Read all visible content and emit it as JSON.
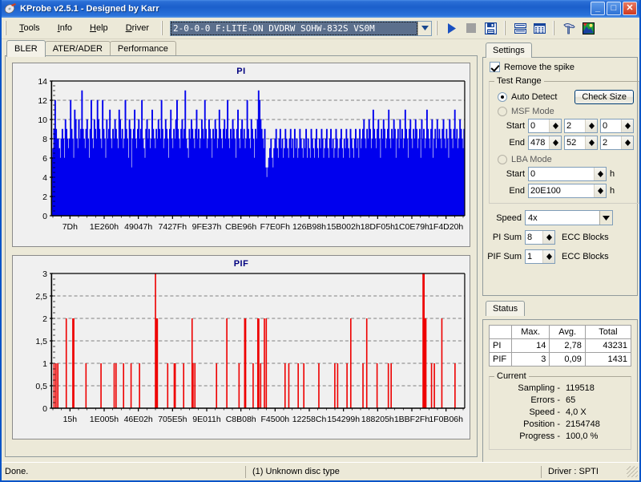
{
  "window": {
    "title": "KProbe v2.5.1 - Designed by Karr",
    "icon": "app-icon",
    "minimize": "_",
    "maximize": "□",
    "close": "✕"
  },
  "menu": {
    "items": [
      {
        "label": "Tools",
        "accel": "T"
      },
      {
        "label": "Info",
        "accel": "I"
      },
      {
        "label": "Help",
        "accel": "H"
      },
      {
        "label": "Driver",
        "accel": "D"
      }
    ]
  },
  "toolbar": {
    "drive": {
      "value": "2-0-0-0 F:LITE-ON DVDRW SOHW-832S  VS0M",
      "arrow_icon": "chevron-down-icon"
    },
    "buttons": [
      {
        "name": "start-scan-button",
        "icon": "play-icon"
      },
      {
        "name": "stop-scan-button",
        "icon": "stop-icon"
      },
      {
        "name": "save-button",
        "icon": "floppy-disk-icon"
      },
      {
        "name": "view-list-button",
        "icon": "list-view-icon"
      },
      {
        "name": "view-grid-button",
        "icon": "grid-view-icon"
      },
      {
        "name": "tools-button",
        "icon": "hammer-icon"
      },
      {
        "name": "image-button",
        "icon": "picture-icon"
      }
    ]
  },
  "tabs": [
    {
      "label": "BLER",
      "active": true
    },
    {
      "label": "ATER/ADER",
      "active": false
    },
    {
      "label": "Performance",
      "active": false
    }
  ],
  "settings": {
    "tab_label": "Settings",
    "remove_spike": {
      "label": "Remove the spike",
      "checked": true
    },
    "test_range": {
      "legend": "Test Range",
      "auto_detect": {
        "label": "Auto Detect",
        "selected": true
      },
      "check_size_button": "Check Size",
      "msf_mode": {
        "label": "MSF Mode",
        "selected": false
      },
      "msf_start": {
        "label": "Start",
        "values": [
          "0",
          "2",
          "0"
        ]
      },
      "msf_end": {
        "label": "End",
        "values": [
          "478",
          "52",
          "2"
        ]
      },
      "lba_mode": {
        "label": "LBA Mode",
        "selected": false
      },
      "lba_start": {
        "label": "Start",
        "value": "0",
        "unit": "h"
      },
      "lba_end": {
        "label": "End",
        "value": "20E100",
        "unit": "h"
      }
    },
    "speed": {
      "label": "Speed",
      "value": "4x"
    },
    "pi_sum": {
      "label": "PI Sum",
      "value": "8",
      "unit": "ECC Blocks"
    },
    "pif_sum": {
      "label": "PIF Sum",
      "value": "1",
      "unit": "ECC Blocks"
    }
  },
  "status_panel": {
    "tab_label": "Status",
    "table": {
      "headers": [
        "",
        "Max.",
        "Avg.",
        "Total"
      ],
      "rows": [
        {
          "name": "PI",
          "max": "14",
          "avg": "2,78",
          "total": "43231"
        },
        {
          "name": "PIF",
          "max": "3",
          "avg": "0,09",
          "total": "1431"
        }
      ]
    },
    "current": {
      "legend": "Current",
      "rows": [
        {
          "label": "Sampling -",
          "value": "119518"
        },
        {
          "label": "Errors -",
          "value": "65"
        },
        {
          "label": "Speed -",
          "value": "4,0  X"
        },
        {
          "label": "Position -",
          "value": "2154748"
        },
        {
          "label": "Progress -",
          "value": "100,0 %"
        }
      ]
    }
  },
  "statusbar": {
    "left": "Done.",
    "center": "(1) Unknown disc type",
    "right": "Driver : SPTI"
  },
  "colors": {
    "pi_series": "#0000ee",
    "pif_series": "#ee0000",
    "chart_title": "#000080",
    "chart_bg": "#f0f0f0",
    "title_bar": "#1b5fcb",
    "panel_bg": "#ece9d8"
  },
  "chart_data": [
    {
      "type": "bar",
      "title": "PI",
      "xlabel": "",
      "ylabel": "",
      "ylim": [
        0,
        14
      ],
      "yticks": [
        0,
        2,
        4,
        6,
        8,
        10,
        12,
        14
      ],
      "ytick_labels": [
        "0",
        "2",
        "4",
        "6",
        "8",
        "10",
        "12",
        "14"
      ],
      "gridlines": [
        8,
        10,
        12
      ],
      "grid": true,
      "color": "#0000ee",
      "xtick_labels": [
        "7Dh",
        "1E260h",
        "49047h",
        "7427Fh",
        "9FE37h",
        "CBE96h",
        "F7E0Fh",
        "126B98h",
        "15B002h",
        "18DF05h",
        "1C0E79h",
        "1F4D20h"
      ],
      "values": [
        6,
        7,
        9,
        12,
        9,
        8,
        8,
        7,
        6,
        8,
        9,
        8,
        6,
        10,
        9,
        8,
        7,
        8,
        12,
        9,
        8,
        6,
        11,
        10,
        8,
        7,
        10,
        8,
        9,
        13,
        9,
        8,
        7,
        9,
        10,
        8,
        6,
        9,
        12,
        8,
        7,
        10,
        9,
        8,
        12,
        10,
        9,
        8,
        7,
        12,
        9,
        8,
        6,
        10,
        8,
        9,
        11,
        8,
        7,
        9,
        8,
        10,
        9,
        8,
        7,
        11,
        10,
        8,
        9,
        7,
        8,
        12,
        9,
        8,
        6,
        10,
        9,
        5,
        8,
        9,
        11,
        8,
        7,
        9,
        10,
        8,
        9,
        12,
        8,
        7,
        6,
        9,
        10,
        8,
        9,
        7,
        8,
        11,
        9,
        8,
        7,
        9,
        8,
        10,
        9,
        8,
        12,
        9,
        7,
        8,
        10,
        9,
        8,
        6,
        9,
        11,
        8,
        7,
        9,
        8,
        10,
        12,
        9,
        8,
        7,
        9,
        10,
        8,
        9,
        13,
        8,
        7,
        6,
        9,
        8,
        10,
        9,
        8,
        7,
        9,
        11,
        8,
        9,
        7,
        8,
        10,
        9,
        8,
        12,
        9,
        7,
        8,
        10,
        9,
        8,
        6,
        9,
        8,
        10,
        9,
        7,
        8,
        11,
        9,
        8,
        7,
        9,
        10,
        8,
        9,
        12,
        8,
        7,
        9,
        8,
        10,
        9,
        8,
        6,
        9,
        11,
        8,
        7,
        9,
        10,
        8,
        9,
        7,
        8,
        12,
        9,
        8,
        7,
        10,
        9,
        8,
        6,
        9,
        8,
        10,
        13,
        12,
        10,
        9,
        8,
        7,
        9,
        5,
        4,
        5,
        6,
        7,
        8,
        6,
        5,
        7,
        8,
        9,
        7,
        6,
        8,
        9,
        7,
        8,
        6,
        7,
        9,
        8,
        7,
        6,
        8,
        9,
        7,
        8,
        6,
        9,
        7,
        8,
        6,
        7,
        9,
        8,
        7,
        6,
        8,
        7,
        9,
        6,
        8,
        7,
        6,
        9,
        8,
        7,
        6,
        8,
        9,
        7,
        6,
        8,
        7,
        9,
        8,
        6,
        7,
        8,
        9,
        7,
        6,
        8,
        9,
        7,
        8,
        6,
        7,
        9,
        8,
        6,
        7,
        8,
        9,
        7,
        6,
        8,
        7,
        9,
        8,
        7,
        6,
        9,
        8,
        7,
        6,
        8,
        9,
        7,
        8,
        6,
        9,
        7,
        8,
        9,
        10,
        8,
        7,
        9,
        8,
        10,
        9,
        7,
        8,
        11,
        9,
        8,
        7,
        9,
        10,
        8,
        6,
        9,
        8,
        10,
        9,
        7,
        8,
        9,
        11,
        8,
        7,
        9,
        8,
        10,
        9,
        6,
        8,
        9,
        7,
        10,
        8,
        9,
        7,
        8,
        11,
        9,
        8,
        6,
        9,
        10,
        8,
        7,
        9,
        8,
        10,
        9,
        7,
        8,
        9,
        6,
        10,
        8,
        9,
        7,
        8,
        11,
        9,
        8,
        7,
        9,
        10,
        6,
        8,
        9,
        7,
        10,
        8,
        9,
        8,
        7,
        9,
        10,
        8,
        7,
        9,
        8,
        6,
        10,
        9,
        8,
        7,
        9,
        11,
        8,
        9,
        7,
        8,
        10,
        9,
        8,
        7,
        9
      ]
    },
    {
      "type": "bar",
      "title": "PIF",
      "xlabel": "",
      "ylabel": "",
      "ylim": [
        0,
        3
      ],
      "yticks": [
        0,
        0.5,
        1,
        1.5,
        2,
        2.5,
        3
      ],
      "ytick_labels": [
        "0",
        "0,5",
        "1",
        "1,5",
        "2",
        "2,5",
        "3"
      ],
      "gridlines": [
        0.5,
        1,
        1.5,
        2,
        2.5
      ],
      "grid": true,
      "color": "#ee0000",
      "xtick_labels": [
        "15h",
        "1E005h",
        "46E02h",
        "705E5h",
        "9E011h",
        "C8B08h",
        "F4500h",
        "12258Ch",
        "154299h",
        "188205h",
        "1BBF2Fh",
        "1F0B06h"
      ],
      "spikes": [
        {
          "x": 2,
          "y": 1
        },
        {
          "x": 4,
          "y": 1
        },
        {
          "x": 6,
          "y": 1
        },
        {
          "x": 15,
          "y": 2
        },
        {
          "x": 22,
          "y": 2
        },
        {
          "x": 23,
          "y": 2
        },
        {
          "x": 36,
          "y": 1
        },
        {
          "x": 52,
          "y": 1
        },
        {
          "x": 66,
          "y": 1
        },
        {
          "x": 68,
          "y": 1
        },
        {
          "x": 76,
          "y": 1
        },
        {
          "x": 84,
          "y": 1
        },
        {
          "x": 93,
          "y": 1
        },
        {
          "x": 110,
          "y": 3
        },
        {
          "x": 111,
          "y": 2
        },
        {
          "x": 112,
          "y": 2
        },
        {
          "x": 123,
          "y": 1
        },
        {
          "x": 130,
          "y": 1
        },
        {
          "x": 131,
          "y": 1
        },
        {
          "x": 140,
          "y": 1
        },
        {
          "x": 149,
          "y": 2
        },
        {
          "x": 150,
          "y": 1
        },
        {
          "x": 152,
          "y": 1
        },
        {
          "x": 175,
          "y": 1
        },
        {
          "x": 186,
          "y": 2
        },
        {
          "x": 199,
          "y": 1
        },
        {
          "x": 205,
          "y": 2
        },
        {
          "x": 206,
          "y": 2
        },
        {
          "x": 214,
          "y": 1
        },
        {
          "x": 219,
          "y": 2
        },
        {
          "x": 220,
          "y": 2
        },
        {
          "x": 222,
          "y": 1
        },
        {
          "x": 226,
          "y": 2
        },
        {
          "x": 228,
          "y": 2
        },
        {
          "x": 248,
          "y": 1
        },
        {
          "x": 252,
          "y": 1
        },
        {
          "x": 262,
          "y": 1
        },
        {
          "x": 268,
          "y": 1
        },
        {
          "x": 284,
          "y": 1
        },
        {
          "x": 301,
          "y": 1
        },
        {
          "x": 304,
          "y": 1
        },
        {
          "x": 314,
          "y": 1
        },
        {
          "x": 318,
          "y": 2
        },
        {
          "x": 331,
          "y": 1
        },
        {
          "x": 335,
          "y": 2
        },
        {
          "x": 346,
          "y": 1
        },
        {
          "x": 358,
          "y": 1
        },
        {
          "x": 361,
          "y": 1
        },
        {
          "x": 395,
          "y": 3
        },
        {
          "x": 396,
          "y": 3
        },
        {
          "x": 397,
          "y": 2
        },
        {
          "x": 398,
          "y": 2
        },
        {
          "x": 404,
          "y": 1
        },
        {
          "x": 407,
          "y": 1
        },
        {
          "x": 415,
          "y": 2
        },
        {
          "x": 429,
          "y": 1
        }
      ]
    }
  ]
}
